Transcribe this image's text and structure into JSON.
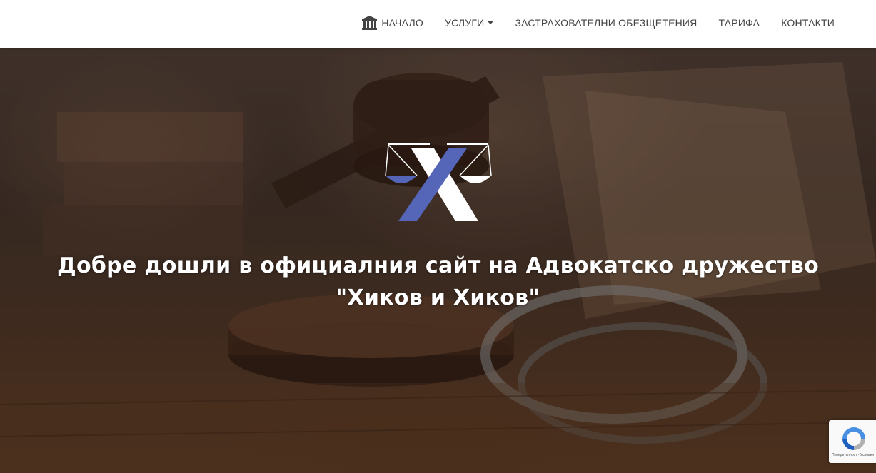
{
  "nav": {
    "items": [
      {
        "label": "НАЧАЛО",
        "icon": "bank-icon"
      },
      {
        "label": "УСЛУГИ",
        "dropdown": true
      },
      {
        "label": "ЗАСТРАХОВАТЕЛНИ ОБЕЗЩЕТЕНИЯ"
      },
      {
        "label": "ТАРИФА"
      },
      {
        "label": "КОНТАКТИ"
      }
    ]
  },
  "hero": {
    "title_line1": "Добре дошли в официалния сайт на Адвокатско дружество",
    "title_line2": "\"Хиков и Хиков\"",
    "logo": {
      "icon": "scales-x-logo",
      "colors": {
        "blue": "#5566b8",
        "white": "#ffffff"
      }
    }
  },
  "recaptcha": {
    "text": "Поверителност - Условия"
  },
  "colors": {
    "nav_bg": "#ffffff",
    "nav_text": "#444444",
    "hero_text": "#ffffff"
  }
}
